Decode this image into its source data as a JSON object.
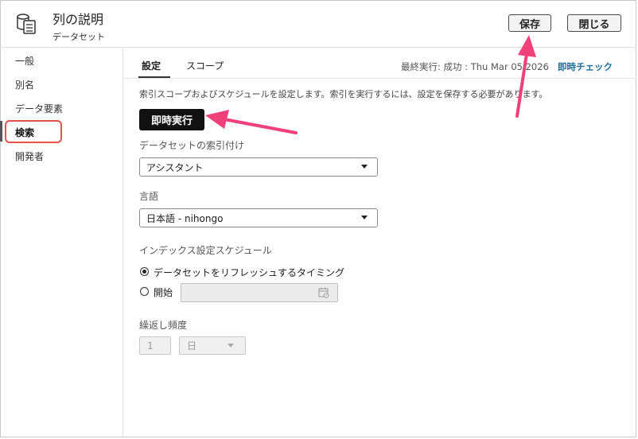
{
  "header": {
    "title": "列の説明",
    "subtitle": "データセット",
    "icon": "dataset-icon",
    "save_label": "保存",
    "close_label": "閉じる"
  },
  "sidebar": {
    "items": [
      {
        "label": "一般"
      },
      {
        "label": "別名"
      },
      {
        "label": "データ要素"
      },
      {
        "label": "検索",
        "selected": true
      },
      {
        "label": "開発者"
      }
    ]
  },
  "tabs": [
    {
      "label": "設定",
      "active": true
    },
    {
      "label": "スコープ",
      "active": false
    }
  ],
  "status": {
    "text": "最終実行: 成功 : Thu Mar 05 2026",
    "link": "即時チェック"
  },
  "main": {
    "description": "索引スコープおよびスケジュールを設定します。索引を実行するには、設定を保存する必要があります。",
    "run_now_label": "即時実行",
    "indexing_label": "データセットの索引付け",
    "indexing_value": "アシスタント",
    "language_label": "言語",
    "language_value": "日本語 - nihongo",
    "schedule_label": "インデックス設定スケジュール",
    "schedule_options": [
      {
        "label": "データセットをリフレッシュするタイミング",
        "selected": true
      },
      {
        "label": "開始",
        "selected": false
      }
    ],
    "frequency_label": "繰返し頻度",
    "frequency_value": "1",
    "frequency_unit": "日"
  },
  "colors": {
    "annotation_arrow": "#f0407a",
    "selection_outline": "#e8504e",
    "link": "#1f6f9e"
  }
}
